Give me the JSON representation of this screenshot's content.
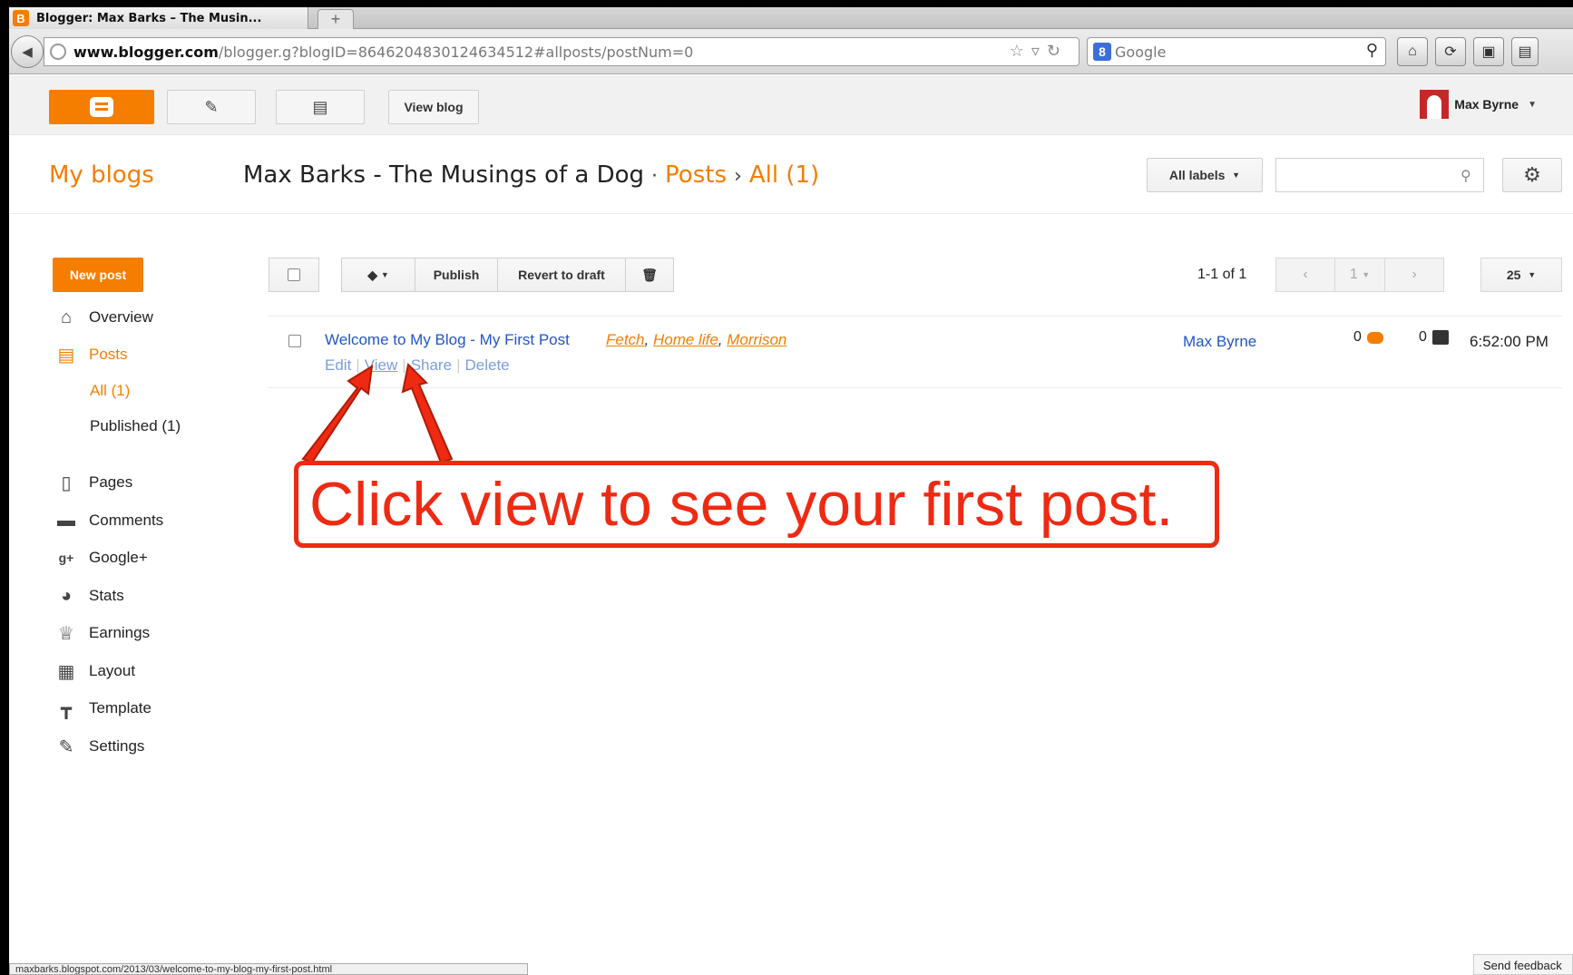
{
  "browser": {
    "tab_title": "Blogger: Max Barks – The Musin...",
    "new_tab_label": "+",
    "url_domain": "www.blogger.com",
    "url_path": "/blogger.g?blogID=8646204830124634512#allposts/postNum=0",
    "search_engine": "Google",
    "status_url": "maxbarks.blogspot.com/2013/03/welcome-to-my-blog-my-first-post.html"
  },
  "header": {
    "view_blog_label": "View blog",
    "user_name": "Max Byrne"
  },
  "titlerow": {
    "my_blogs": "My blogs",
    "blog_name": "Max Barks - The Musings of a Dog",
    "dot": "·",
    "posts": "Posts",
    "arrow": "›",
    "all": "All (1)",
    "all_labels": "All labels",
    "search_placeholder": ""
  },
  "sidebar": {
    "new_post": "New post",
    "items": [
      {
        "label": "Overview",
        "icon": "home-icon"
      },
      {
        "label": "Posts",
        "icon": "posts-icon"
      },
      {
        "label": "Pages",
        "icon": "page-icon"
      },
      {
        "label": "Comments",
        "icon": "comment-icon"
      },
      {
        "label": "Google+",
        "icon": "google-plus-icon"
      },
      {
        "label": "Stats",
        "icon": "pie-chart-icon"
      },
      {
        "label": "Earnings",
        "icon": "trophy-icon"
      },
      {
        "label": "Layout",
        "icon": "layout-icon"
      },
      {
        "label": "Template",
        "icon": "paint-roller-icon"
      },
      {
        "label": "Settings",
        "icon": "wrench-icon"
      }
    ],
    "sub_all": "All (1)",
    "sub_published": "Published (1)"
  },
  "toolbar": {
    "publish": "Publish",
    "revert": "Revert to draft",
    "pager_text": "1-1 of 1",
    "page_num": "1",
    "per_page": "25"
  },
  "post": {
    "title": "Welcome to My Blog - My First Post",
    "labels": [
      "Fetch",
      "Home life",
      "Morrison"
    ],
    "actions": {
      "edit": "Edit",
      "view": "View",
      "share": "Share",
      "delete": "Delete"
    },
    "author": "Max Byrne",
    "comments": "0",
    "views": "0",
    "time": "6:52:00 PM"
  },
  "annotation": {
    "text": "Click view to see your first post."
  },
  "footer": {
    "send_feedback": "Send feedback"
  },
  "colors": {
    "accent": "#f57d00",
    "link": "#2255c8",
    "annotation": "#ee2a13"
  }
}
